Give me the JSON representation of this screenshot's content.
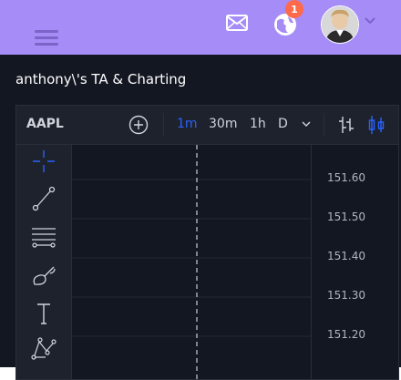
{
  "header": {
    "notification_count": "1",
    "icons": {
      "menu": "hamburger-menu-icon",
      "messages": "mail-icon",
      "notifications": "globe-icon",
      "profile": "user-avatar",
      "profile_menu": "chevron-down-icon"
    }
  },
  "page": {
    "title": "anthony\\'s TA & Charting"
  },
  "chart": {
    "symbol": "AAPL",
    "intervals": [
      "1m",
      "30m",
      "1h",
      "D"
    ],
    "active_interval": "1m",
    "price_ticks": [
      "151.60",
      "151.50",
      "151.40",
      "151.30",
      "151.20"
    ],
    "drawing_tools": [
      "crosshair-icon",
      "trend-line-icon",
      "horizontal-lines-icon",
      "brush-icon",
      "text-icon",
      "pattern-icon"
    ]
  },
  "colors": {
    "header_bg": "#a58cf7",
    "main_bg": "#131722",
    "panel_bg": "#1e222d",
    "accent": "#2962ff",
    "badge": "#ff6a4a",
    "text": "#d1d4dc"
  }
}
